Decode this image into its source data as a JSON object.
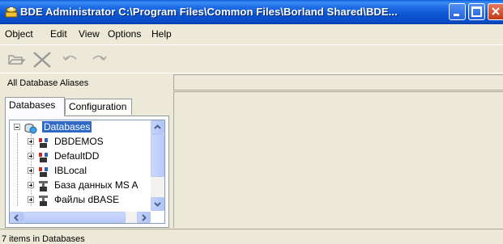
{
  "window": {
    "title": "BDE Administrator  C:\\Program Files\\Common Files\\Borland Shared\\BDE...",
    "app_icon": "bde-admin-icon"
  },
  "title_buttons": [
    "minimize",
    "maximize",
    "close"
  ],
  "menu": [
    "Object",
    "Edit",
    "View",
    "Options",
    "Help"
  ],
  "toolbar": {
    "buttons": [
      "open-folder-icon",
      "delete-x-icon",
      "undo-icon",
      "redo-icon"
    ]
  },
  "left_header_label": "All Database Aliases",
  "tabs": [
    "Databases",
    "Configuration"
  ],
  "tree": {
    "root": "Databases",
    "items": [
      "DBDEMOS",
      "DefaultDD",
      "IBLocal",
      "База данных MS A",
      "Файлы dBASE"
    ]
  },
  "status": "7 items in Databases"
}
